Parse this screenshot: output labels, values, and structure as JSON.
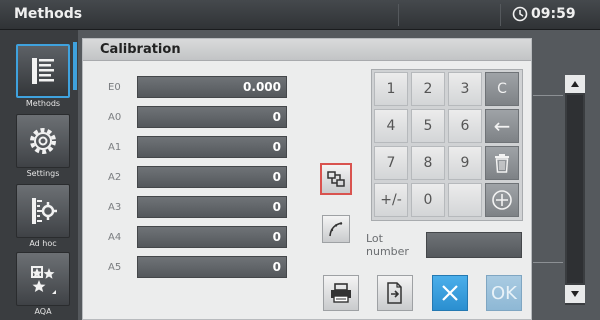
{
  "header": {
    "title": "Methods",
    "time": "09:59"
  },
  "sidebar": {
    "items": [
      {
        "label": "Methods",
        "icon": "methods-list-icon"
      },
      {
        "label": "Settings",
        "icon": "gear-icon"
      },
      {
        "label": "Ad hoc",
        "icon": "sample-probe-icon"
      },
      {
        "label": "AQA",
        "icon": "stars-icon"
      }
    ]
  },
  "panel": {
    "title": "Calibration",
    "coefficients": [
      {
        "label": "E0",
        "value": "0.000"
      },
      {
        "label": "A0",
        "value": "0"
      },
      {
        "label": "A1",
        "value": "0"
      },
      {
        "label": "A2",
        "value": "0"
      },
      {
        "label": "A3",
        "value": "0"
      },
      {
        "label": "A4",
        "value": "0"
      },
      {
        "label": "A5",
        "value": "0"
      }
    ],
    "tools": [
      {
        "icon": "convert-icon",
        "selected": true
      },
      {
        "icon": "curve-icon",
        "selected": false
      }
    ],
    "keypad": [
      "1",
      "2",
      "3",
      "C",
      "4",
      "5",
      "6",
      "←",
      "7",
      "8",
      "9",
      "",
      "+/-",
      "0",
      "",
      ""
    ],
    "lot_label_line1": "Lot",
    "lot_label_line2": "number",
    "lot_value": "",
    "ok_label": "OK"
  },
  "colors": {
    "accent": "#3fa2de",
    "selected_outline": "#d9534f",
    "field": "#5f6367"
  }
}
